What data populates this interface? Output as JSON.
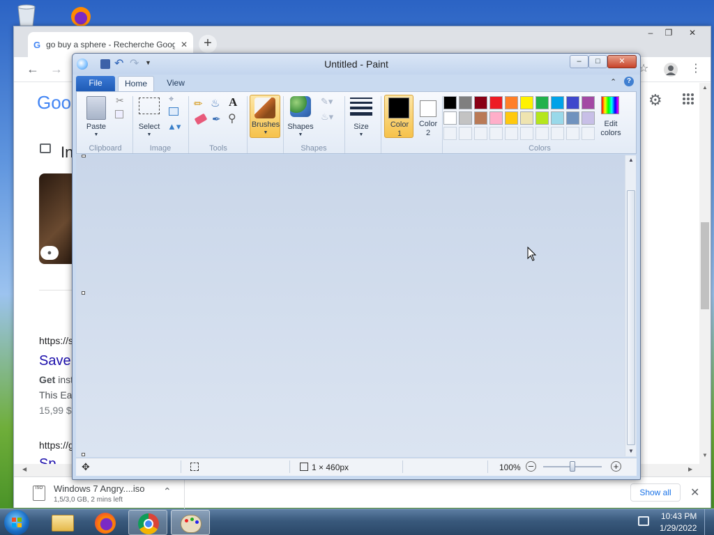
{
  "chrome": {
    "tab_title": "go buy a sphere - Recherche Google",
    "tab_close": "✕",
    "new_tab": "+",
    "logo_partial": "Goo",
    "section_initial": "In",
    "results": [
      {
        "url": "https://s",
        "title": "Save",
        "line1_bold": "Get",
        "line1": " inst",
        "line2": "This Ea",
        "price": "15,99 $"
      },
      {
        "url": "https://g",
        "title": "Sp"
      }
    ],
    "download": {
      "file": "Windows 7 Angry....iso",
      "progress": "1,5/3,0 GB, 2 mins left",
      "show_all": "Show all"
    }
  },
  "paint": {
    "title": "Untitled - Paint",
    "tabs": {
      "file": "File",
      "home": "Home",
      "view": "View"
    },
    "groups": {
      "clipboard": {
        "label": "Clipboard",
        "paste": "Paste"
      },
      "image": {
        "label": "Image",
        "select": "Select"
      },
      "tools": {
        "label": "Tools"
      },
      "brushes": "Brushes",
      "shapes": {
        "label": "Shapes",
        "shapes_btn": "Shapes"
      },
      "size": "Size",
      "color1": {
        "l1": "Color",
        "l2": "1"
      },
      "color2": {
        "l1": "Color",
        "l2": "2"
      },
      "colors": {
        "label": "Colors",
        "edit_l1": "Edit",
        "edit_l2": "colors"
      }
    },
    "palette_row1": [
      "#000000",
      "#7f7f7f",
      "#880015",
      "#ed1c24",
      "#ff7f27",
      "#fff200",
      "#22b14c",
      "#00a2e8",
      "#3f48cc",
      "#a349a4"
    ],
    "palette_row2": [
      "#ffffff",
      "#c3c3c3",
      "#b97a57",
      "#ffaec9",
      "#ffc90e",
      "#efe4b0",
      "#b5e61d",
      "#99d9ea",
      "#7092be",
      "#c8bfe7"
    ],
    "color1_value": "#000000",
    "color2_value": "#ffffff",
    "status": {
      "size": "1 × 460px",
      "zoom": "100%"
    }
  },
  "taskbar": {
    "time": "10:43 PM",
    "date": "1/29/2022"
  }
}
